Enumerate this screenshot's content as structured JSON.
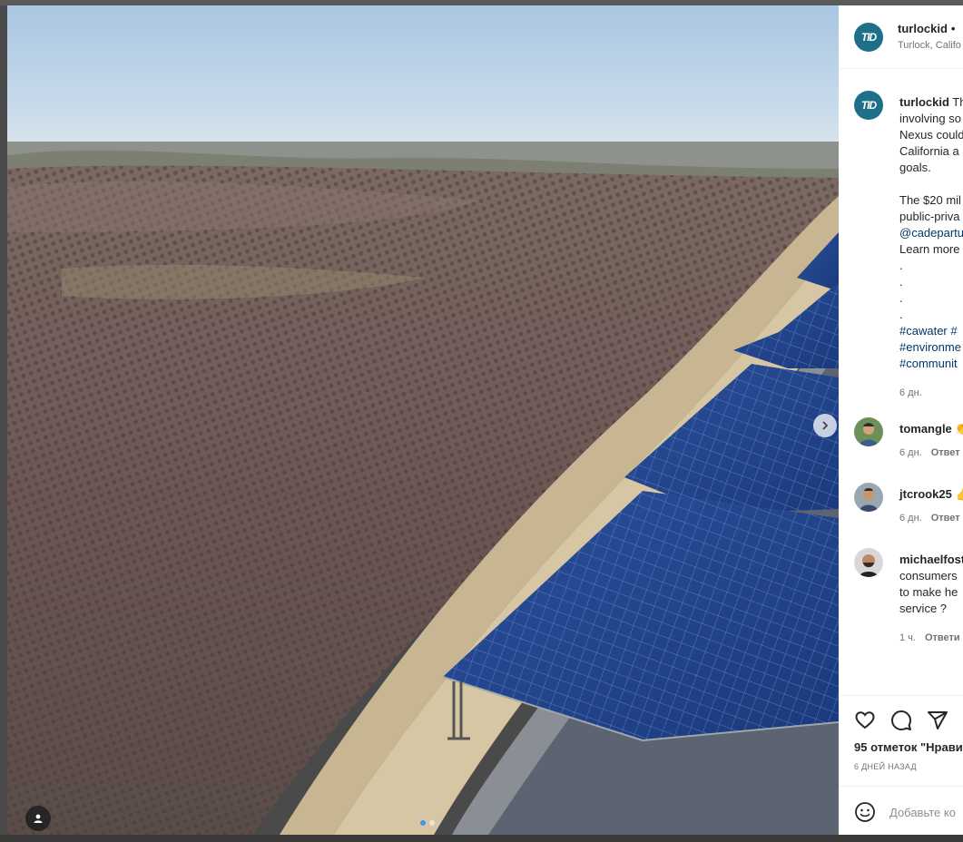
{
  "post": {
    "author": "turlockid",
    "author_initials": "TID",
    "separator": "•",
    "location": "Turlock, Califo",
    "photo_alt": "Aerial view of orchard and canal with solar panels"
  },
  "caption": {
    "author": "turlockid",
    "lines": [
      "Th",
      "involving so",
      "Nexus could",
      "California a",
      "goals."
    ],
    "lines2": [
      "The $20 mil",
      "public-priva"
    ],
    "link": "@cadepartu",
    "learn_more": "Learn more",
    "dots": [
      ".",
      ".",
      ".",
      "."
    ],
    "hashtags": [
      "#cawater #",
      "#environme",
      "#communit"
    ],
    "time": "6 дн."
  },
  "comments": [
    {
      "user": "tomangle",
      "text_suffix": "",
      "time": "6 дн.",
      "reply": "Ответ"
    },
    {
      "user": "jtcrook25",
      "text_suffix": "",
      "time": "6 дн.",
      "reply": "Ответ"
    },
    {
      "user": "michaelfost",
      "lines": [
        "consumers",
        "to make he",
        "service ?"
      ],
      "time": "1 ч.",
      "reply": "Ответи"
    }
  ],
  "actions": {
    "likes": "95 отметок \"Нрави",
    "date": "6 ДНЕЙ НАЗАД"
  },
  "add_comment": {
    "placeholder": "Добавьте ко"
  },
  "icons": {
    "like": "heart-icon",
    "comment": "comment-icon",
    "share": "send-icon",
    "emoji": "emoji-icon",
    "next": "chevron-right-icon",
    "tag": "user-tag-icon"
  },
  "colors": {
    "brand": "#1d6f8a",
    "link": "#00376b",
    "active_dot": "#3897f0"
  }
}
